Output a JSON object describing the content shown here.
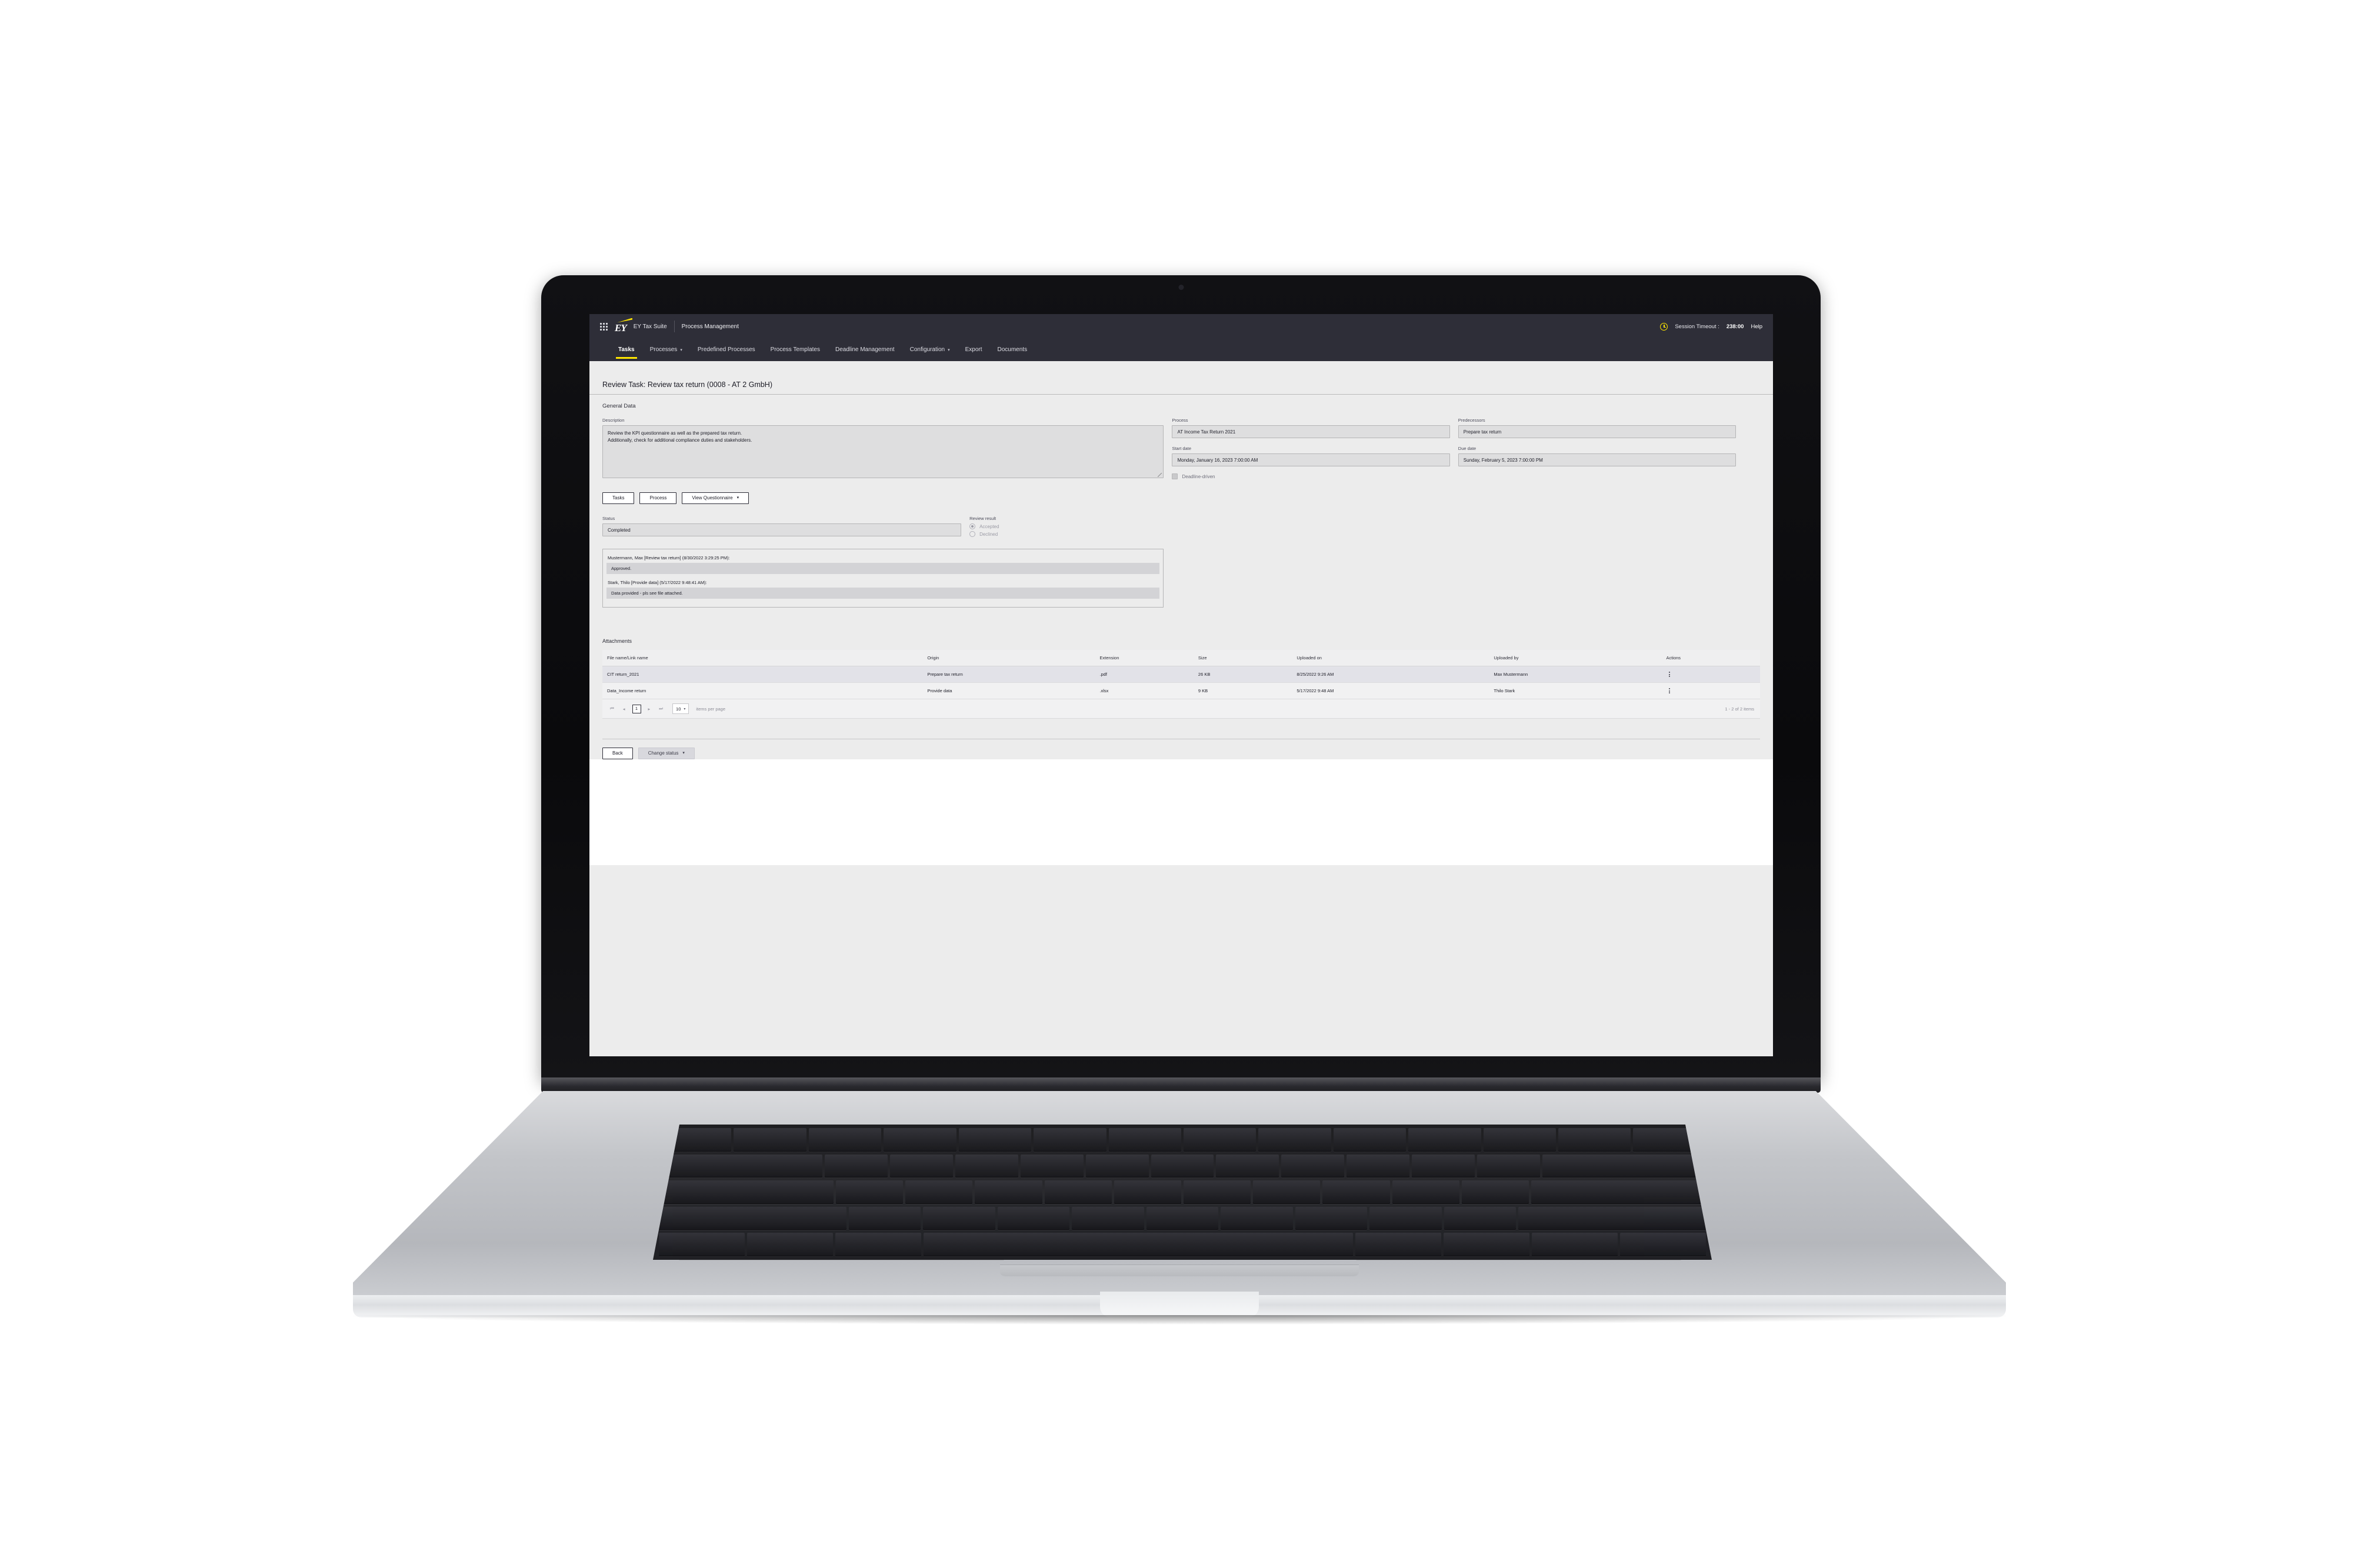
{
  "topbar": {
    "waffle_icon": "grid-apps-icon",
    "brand_mark": "EY",
    "suite_name": "EY Tax Suite",
    "module_name": "Process Management",
    "clock_icon": "clock-icon",
    "session_timeout_label": "Session Timeout :",
    "session_timeout_value": "238:00",
    "help_label": "Help"
  },
  "nav": {
    "items": [
      {
        "label": "Tasks",
        "active": true,
        "has_caret": false
      },
      {
        "label": "Processes",
        "active": false,
        "has_caret": true
      },
      {
        "label": "Predefined Processes",
        "active": false,
        "has_caret": false
      },
      {
        "label": "Process Templates",
        "active": false,
        "has_caret": false
      },
      {
        "label": "Deadline Management",
        "active": false,
        "has_caret": false
      },
      {
        "label": "Configuration",
        "active": false,
        "has_caret": true
      },
      {
        "label": "Export",
        "active": false,
        "has_caret": false
      },
      {
        "label": "Documents",
        "active": false,
        "has_caret": false
      }
    ]
  },
  "page": {
    "title": "Review Task: Review tax return (0008 - AT 2 GmbH)",
    "section_title": "General Data"
  },
  "general": {
    "description_label": "Description",
    "description_line1": "Review the KPI questionnaire as well as the prepared tax return.",
    "description_line2": "Additionally, check for additional compliance duties and stakeholders.",
    "process_label": "Process",
    "process_value": "AT Income Tax Return 2021",
    "predecessors_label": "Predecessors",
    "predecessors_value": "Prepare tax return",
    "start_date_label": "Start date",
    "start_date_value": "Monday, January 16, 2023 7:00:00 AM",
    "due_date_label": "Due date",
    "due_date_value": "Sunday, February 5, 2023 7:00:00 PM",
    "deadline_driven_label": "Deadline-driven"
  },
  "actions": {
    "tasks_label": "Tasks",
    "process_label": "Process",
    "view_questionnaire_label": "View Questionnaire",
    "caret": "▾"
  },
  "status": {
    "status_label": "Status",
    "status_value": "Completed",
    "review_result_label": "Review result",
    "accepted_label": "Accepted",
    "declined_label": "Declined"
  },
  "comments": [
    {
      "author": "Mustermann, Max [Review tax return] (8/30/2022 3:29:25 PM):",
      "text": "Approved."
    },
    {
      "author": "Stark, Thilo [Provide data] (5/17/2022 9:48:41 AM):",
      "text": "Data provided - pls see file attached."
    }
  ],
  "attachments": {
    "title": "Attachments",
    "columns": [
      "File name/Link name",
      "Origin",
      "Extension",
      "Size",
      "Uploaded on",
      "Uploaded by",
      "Actions"
    ],
    "rows": [
      {
        "file_name": "CIT return_2021",
        "origin": "Prepare tax return",
        "extension": ".pdf",
        "size": "26 KB",
        "uploaded_on": "8/25/2022 9:26 AM",
        "uploaded_by": "Max Mustermann",
        "actions_icon": "kebab-menu-icon"
      },
      {
        "file_name": "Data_Income return",
        "origin": "Provide data",
        "extension": ".xlsx",
        "size": "9 KB",
        "uploaded_on": "5/17/2022 9:48 AM",
        "uploaded_by": "Thilo Stark",
        "actions_icon": "kebab-menu-icon"
      }
    ],
    "pager": {
      "first_icon": "⏮",
      "prev_icon": "◂",
      "current_page": "1",
      "next_icon": "▸",
      "last_icon": "⏭",
      "page_size": "10",
      "page_size_caret": "▾",
      "items_per_page_label": "items per page",
      "range_label": "1 - 2 of 2 items"
    }
  },
  "footer": {
    "back_label": "Back",
    "change_status_label": "Change status",
    "change_status_caret": "▾"
  },
  "colors": {
    "brand_dark": "#2e2e38",
    "brand_yellow": "#ffe600",
    "page_bg": "#ececec",
    "field_bg": "#dededf"
  }
}
